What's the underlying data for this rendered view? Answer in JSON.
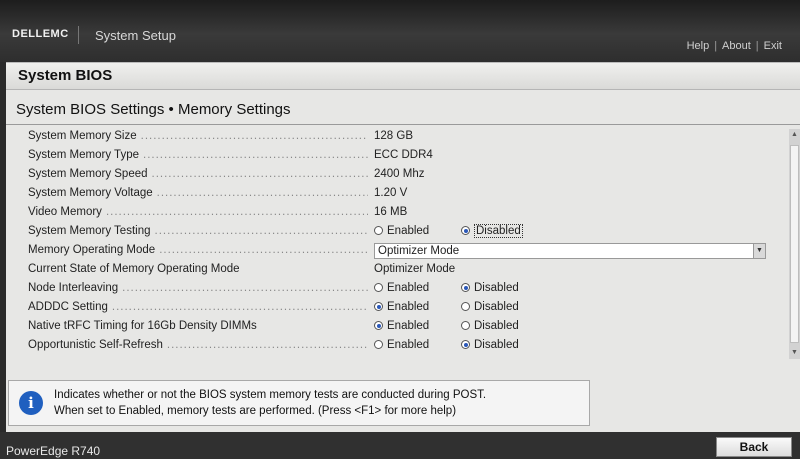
{
  "header": {
    "logo": "DELLEMC",
    "title": "System Setup",
    "links": [
      "Help",
      "About",
      "Exit"
    ]
  },
  "section_title": "System BIOS",
  "page_title": "System BIOS Settings • Memory Settings",
  "settings": [
    {
      "label": "System Memory Size",
      "value": "128 GB"
    },
    {
      "label": "System Memory Type",
      "value": "ECC DDR4"
    },
    {
      "label": "System Memory Speed",
      "value": "2400 Mhz"
    },
    {
      "label": "System Memory Voltage",
      "value": "1.20 V"
    },
    {
      "label": "Video Memory",
      "value": "16 MB"
    },
    {
      "label": "System Memory Testing",
      "options": [
        "Enabled",
        "Disabled"
      ],
      "selected": 1,
      "focused": true
    },
    {
      "label": "Memory Operating Mode",
      "dropdown": "Optimizer Mode"
    },
    {
      "label": "Current State of Memory Operating Mode",
      "value": "Optimizer Mode"
    },
    {
      "label": "Node Interleaving",
      "options": [
        "Enabled",
        "Disabled"
      ],
      "selected": 1
    },
    {
      "label": "ADDDC Setting",
      "options": [
        "Enabled",
        "Disabled"
      ],
      "selected": 0
    },
    {
      "label": "Native tRFC Timing for 16Gb Density DIMMs",
      "options": [
        "Enabled",
        "Disabled"
      ],
      "selected": 0
    },
    {
      "label": "Opportunistic Self-Refresh",
      "options": [
        "Enabled",
        "Disabled"
      ],
      "selected": 1
    }
  ],
  "help": {
    "line1": "Indicates whether or not the BIOS system memory tests are conducted during POST.",
    "line2": "When set to Enabled, memory tests are performed. (Press <F1> for more help)"
  },
  "footer": {
    "model": "PowerEdge R740",
    "back_label": "Back"
  },
  "icons": {
    "info": "info-icon",
    "dropdown": "chevron-down-icon"
  }
}
